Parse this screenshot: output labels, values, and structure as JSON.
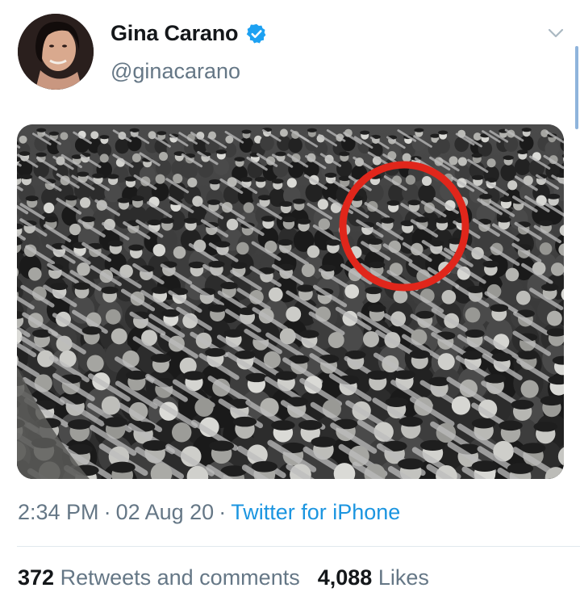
{
  "tweet": {
    "author": {
      "display_name": "Gina Carano",
      "handle": "@ginacarano",
      "verified_icon": "verified-badge-icon"
    },
    "menu_icon": "chevron-down-icon",
    "media": {
      "description_icon": "crowd-photo",
      "highlight_color": "#e0261b"
    },
    "meta": {
      "time": "2:34 PM",
      "separator": "·",
      "date": "02 Aug 20",
      "source": "Twitter for iPhone"
    },
    "stats": {
      "retweets_count": "372",
      "retweets_label": "Retweets and comments",
      "likes_count": "4,088",
      "likes_label": "Likes"
    }
  },
  "colors": {
    "text_primary": "#14171a",
    "text_secondary": "#657786",
    "link": "#1b95e0",
    "verified": "#1da1f2"
  }
}
